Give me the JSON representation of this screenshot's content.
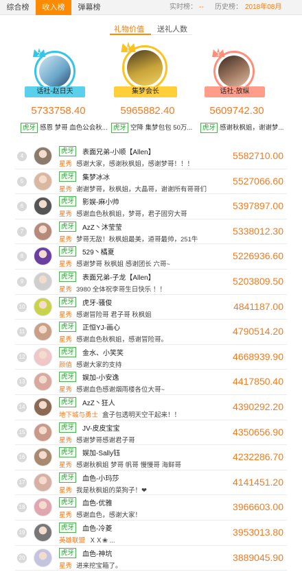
{
  "top_tabs": [
    "综合榜",
    "收入榜",
    "弹幕榜"
  ],
  "realtime": {
    "label": "实时榜：",
    "value": "--"
  },
  "history": {
    "label": "历史榜：",
    "value": "2018年08月"
  },
  "sub_tabs": [
    "礼物价值",
    "送礼人数"
  ],
  "podium": [
    {
      "rank": "2",
      "name": "话社-赵日天",
      "score": "5733758.40",
      "ring_color": "#36c3e8",
      "ribbon_color": "#5ad0ea"
    },
    {
      "rank": "1",
      "name": "集梦会长",
      "score": "5965882.40",
      "ring_color": "#ffc21c",
      "ribbon_color": "#ffcf3a"
    },
    {
      "rank": "3",
      "name": "话社-放纵",
      "score": "5609742.30",
      "ring_color": "#ff8f7a",
      "ribbon_color": "#ff9d8a"
    }
  ],
  "marquee": [
    {
      "platform": "虎牙",
      "text": "感恩 梦哥 血色公会秋..."
    },
    {
      "platform": "虎牙",
      "text": "空降 集梦包包 50万..."
    },
    {
      "platform": "虎牙",
      "text": "感谢秋枫姐，谢谢梦..."
    }
  ],
  "rows": [
    {
      "rank": "4",
      "platform": "虎牙",
      "name": "表面兄弟-小顺【Allen】",
      "tag": "星秀",
      "message": "感谢大家，感谢秋枫姐，感谢梦哥！！！",
      "value": "5582710.00",
      "color": "#8c7b6b"
    },
    {
      "rank": "5",
      "platform": "虎牙",
      "name": "集梦冰冰",
      "tag": "星秀",
      "message": "谢谢梦哥，秋枫姐，大晶哥，谢谢所有哥哥们",
      "value": "5527066.60",
      "color": "#d9b7a0"
    },
    {
      "rank": "6",
      "platform": "虎牙",
      "name": "影娱-麻小帅",
      "tag": "星秀",
      "message": "感谢血色秋枫姐，梦哥，君子固穷大哥",
      "value": "5397897.00",
      "color": "#555555"
    },
    {
      "rank": "7",
      "platform": "虎牙",
      "name": "AzZ丶沐莹莹",
      "tag": "星秀",
      "message": "梦哥无敌！秋枫姐最美，道哥最帅，251牛",
      "value": "5338012.30",
      "color": "#b58a7a"
    },
    {
      "rank": "8",
      "platform": "虎牙",
      "name": "529丶橘夏",
      "tag": "星秀",
      "message": "感谢梦哥 秋枫姐 感谢团长 六哥~",
      "value": "5226936.60",
      "color": "#6a3fa0"
    },
    {
      "rank": "9",
      "platform": "虎牙",
      "name": "表面兄弟-子龙【Allen】",
      "tag": "星秀",
      "message": "3980 全体祝李哥生日快乐 ！！",
      "value": "5203809.50",
      "color": "#cfcfcf"
    },
    {
      "rank": "10",
      "platform": "虎牙",
      "name": "虎牙-骚俊",
      "tag": "星秀",
      "message": "感谢冒险哥 君子哥 秋枫姐",
      "value": "4841187.00",
      "color": "#c9d34a"
    },
    {
      "rank": "11",
      "platform": "虎牙",
      "name": "正恒YJ-画心",
      "tag": "星秀",
      "message": "感谢血色秋枫姐，感谢冒险哥。",
      "value": "4790514.20",
      "color": "#c8a08a"
    },
    {
      "rank": "12",
      "platform": "虎牙",
      "name": "金水、小笑笑",
      "tag": "颜值",
      "message": "感谢大家的支持",
      "value": "4668939.90",
      "color": "#f1c6c6"
    },
    {
      "rank": "13",
      "platform": "虎牙",
      "name": "娱加-小安逸",
      "tag": "星秀",
      "message": "感谢血色感谢烟雨楼各位大哥~",
      "value": "4417850.40",
      "color": "#d9a9a0"
    },
    {
      "rank": "14",
      "platform": "虎牙",
      "name": "AzZ丶狂人",
      "tag": "地下城与勇士",
      "message": "盒子包透明天空干起来！！",
      "value": "4390292.20",
      "color": "#8a6a55"
    },
    {
      "rank": "15",
      "platform": "虎牙",
      "name": "JV-皮皮宝宝",
      "tag": "星秀",
      "message": "感谢梦哥感谢君子哥",
      "value": "4350656.90",
      "color": "#c99a8a"
    },
    {
      "rank": "16",
      "platform": "虎牙",
      "name": "娱加-Sally钰",
      "tag": "星秀",
      "message": "感谢秋枫姐 梦哥 帆哥 慢慢哥 海鲜哥",
      "value": "4232286.70",
      "color": "#a88a70"
    },
    {
      "rank": "17",
      "platform": "虎牙",
      "name": "血色-小玛莎",
      "tag": "星秀",
      "message": "我是秋枫姐的菜狗子！❤",
      "value": "4141451.20",
      "color": "#d7b0a4"
    },
    {
      "rank": "18",
      "platform": "虎牙",
      "name": "血色-优雅",
      "tag": "星秀",
      "message": "感谢血色，感谢大家！",
      "value": "3966603.00",
      "color": "#e0a7b0"
    },
    {
      "rank": "19",
      "platform": "虎牙",
      "name": "血色-冷菱",
      "tag": "英雄联盟",
      "message": "ＸＸ❀    ...",
      "value": "3953013.80",
      "color": "#777777"
    },
    {
      "rank": "20",
      "platform": "虎牙",
      "name": "血色-神坑",
      "tag": "星秀",
      "message": "进来挖宝箱了。",
      "value": "3889045.90",
      "color": "#c4c4e0"
    }
  ]
}
